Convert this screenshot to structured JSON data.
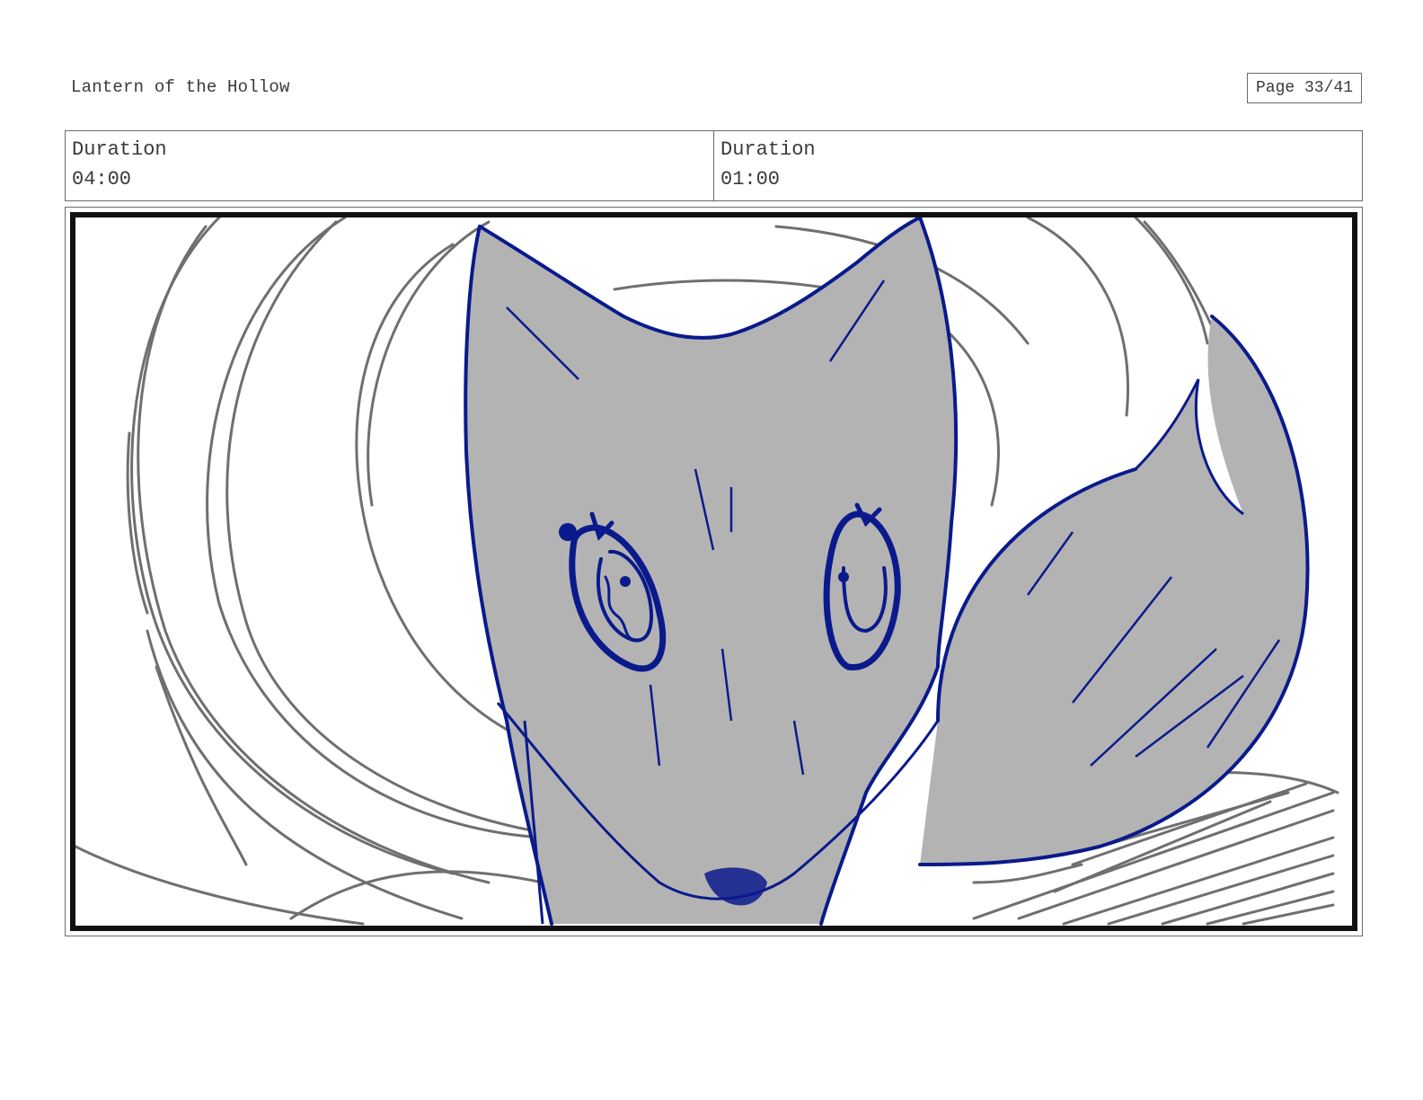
{
  "header": {
    "project_title": "Lantern of the Hollow",
    "page_indicator": "Page 33/41"
  },
  "durations": [
    {
      "label": "Duration",
      "value": "04:00"
    },
    {
      "label": "Duration",
      "value": "01:00"
    }
  ],
  "panel": {
    "subject": "fox-sketch",
    "colors": {
      "outline": "#0a1a8c",
      "fill": "#b3b3b3",
      "background_lines": "#6f6f6f",
      "frame": "#111111"
    }
  }
}
